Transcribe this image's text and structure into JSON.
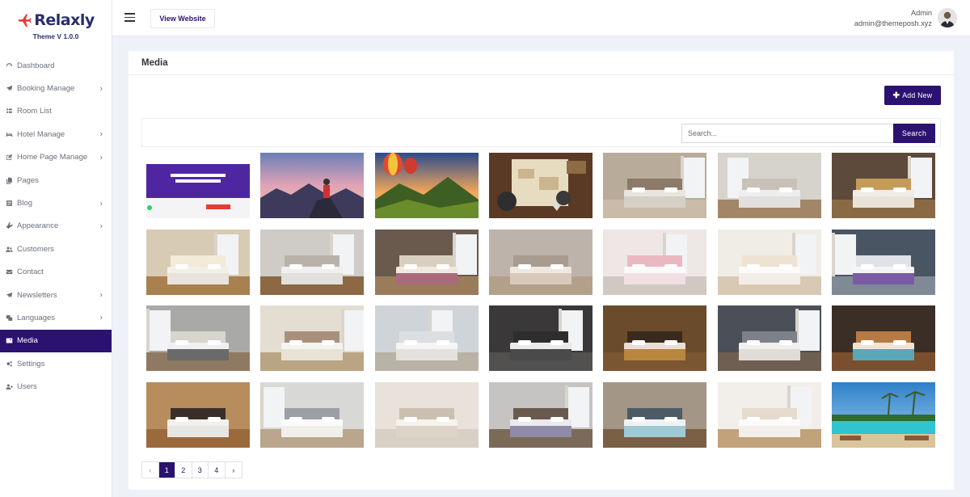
{
  "brand": {
    "logo_text": "Relaxly",
    "version": "Theme V 1.0.0"
  },
  "sidebar": {
    "items": [
      {
        "label": "Dashboard",
        "icon": "dashboard-icon",
        "has_submenu": false
      },
      {
        "label": "Booking Manage",
        "icon": "rocket-icon",
        "has_submenu": true
      },
      {
        "label": "Room List",
        "icon": "list-icon",
        "has_submenu": false
      },
      {
        "label": "Hotel Manage",
        "icon": "bed-icon",
        "has_submenu": true
      },
      {
        "label": "Home Page Manage",
        "icon": "edit-icon",
        "has_submenu": true
      },
      {
        "label": "Pages",
        "icon": "copy-icon",
        "has_submenu": false
      },
      {
        "label": "Blog",
        "icon": "blog-icon",
        "has_submenu": true
      },
      {
        "label": "Appearance",
        "icon": "wrench-icon",
        "has_submenu": true
      },
      {
        "label": "Customers",
        "icon": "users-icon",
        "has_submenu": false
      },
      {
        "label": "Contact",
        "icon": "envelope-icon",
        "has_submenu": false
      },
      {
        "label": "Newsletters",
        "icon": "send-icon",
        "has_submenu": true
      },
      {
        "label": "Languages",
        "icon": "language-icon",
        "has_submenu": true
      },
      {
        "label": "Media",
        "icon": "image-icon",
        "has_submenu": false,
        "active": true
      },
      {
        "label": "Settings",
        "icon": "gears-icon",
        "has_submenu": false
      },
      {
        "label": "Users",
        "icon": "user-plus-icon",
        "has_submenu": false
      }
    ]
  },
  "header": {
    "view_website": "View Website",
    "user_name": "Admin",
    "user_email": "admin@themeposh.xyz"
  },
  "media": {
    "title": "Media",
    "add_new": "Add New",
    "search_placeholder": "Search...",
    "search_button": "Search",
    "thumbnails": [
      "website-screenshot",
      "hiker-mountain-sunset",
      "hot-air-balloons",
      "vintage-map-travel",
      "bedroom-beige-wall",
      "bedroom-wood-panels",
      "bedroom-tufted-headboard",
      "bedroom-classic-window",
      "bedroom-modern-lights",
      "bedroom-star-headboard",
      "bedroom-grey-headboard",
      "bedroom-pink-mural",
      "bedroom-white-wardrobe",
      "bedroom-purple-blanket",
      "bedroom-stone-wall",
      "hotel-room-desk",
      "bedroom-bright-window",
      "bedroom-dark-patterned",
      "bedroom-ornate-gold",
      "bedroom-spiral-mural",
      "bedroom-warm-lamps",
      "bedroom-tv-wood",
      "bedroom-city-view",
      "bedroom-canopy",
      "bedroom-grey-throw",
      "bedroom-orange-pillows",
      "bedroom-white-bright",
      "resort-pool-palms"
    ]
  },
  "pagination": {
    "prev": "‹",
    "pages": [
      "1",
      "2",
      "3",
      "4"
    ],
    "current": "1",
    "next": "›"
  },
  "colors": {
    "primary": "#2b1270",
    "brand_red": "#e63a37",
    "brand_navy": "#2a2e6e"
  }
}
